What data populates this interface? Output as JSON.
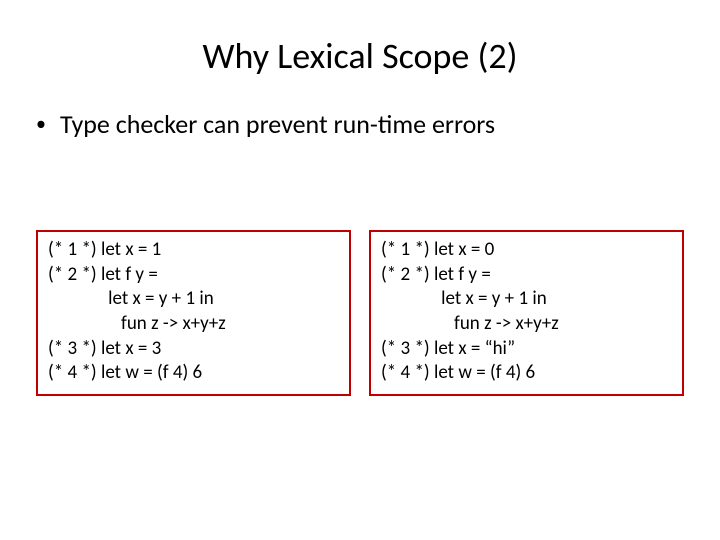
{
  "title": "Why Lexical Scope (2)",
  "bullet": "Type checker can prevent run-time errors",
  "left": {
    "l1": "(* 1 *) let x = 1",
    "l2": "(* 2 *) let f y =",
    "l3": "              let x = y + 1 in",
    "l4": "                 fun z -> x+y+z",
    "l5": "(* 3 *) let x = 3",
    "l6": "(* 4 *) let w = (f 4) 6"
  },
  "right": {
    "l1": "(* 1 *) let x = 0",
    "l2": "(* 2 *) let f y =",
    "l3": "              let x = y + 1 in",
    "l4": "                 fun z -> x+y+z",
    "l5": "(* 3 *) let x = “hi”",
    "l6": "(* 4 *) let w = (f 4) 6"
  }
}
